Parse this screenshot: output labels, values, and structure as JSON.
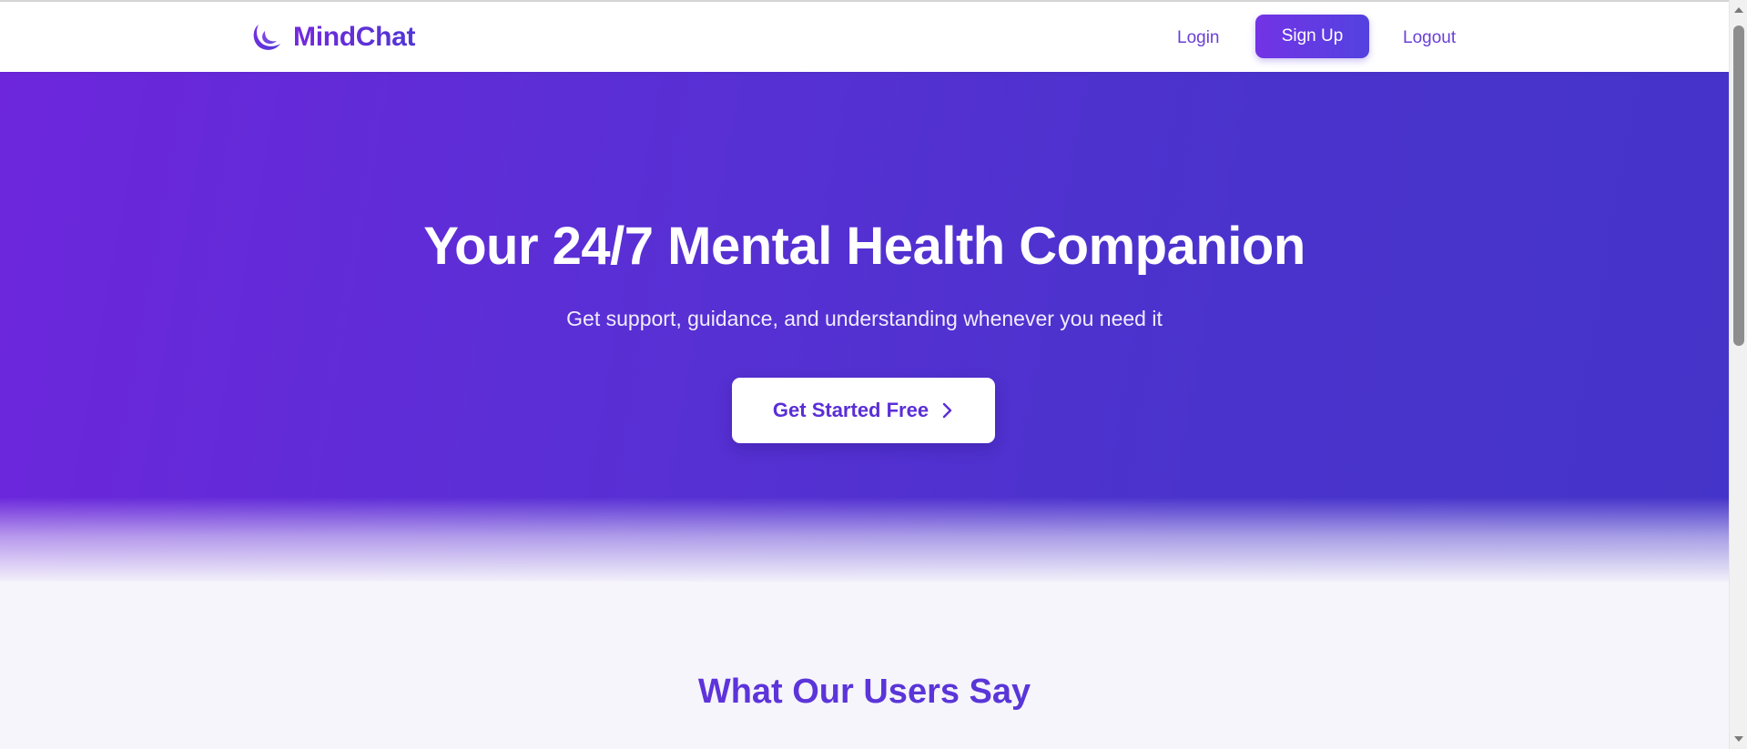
{
  "header": {
    "brand_name": "MindChat",
    "brand_icon": "crescent-moon-icon",
    "nav": {
      "login_label": "Login",
      "signup_label": "Sign Up",
      "logout_label": "Logout"
    }
  },
  "hero": {
    "title": "Your 24/7 Mental Health Companion",
    "subtitle": "Get support, guidance, and understanding whenever you need it",
    "cta_label": "Get Started Free",
    "cta_icon": "chevron-right-icon"
  },
  "testimonials": {
    "title": "What Our Users Say"
  },
  "colors": {
    "brand_purple": "#6d26dc",
    "brand_indigo": "#4534c9",
    "page_background": "#f6f5fb",
    "white": "#ffffff"
  }
}
